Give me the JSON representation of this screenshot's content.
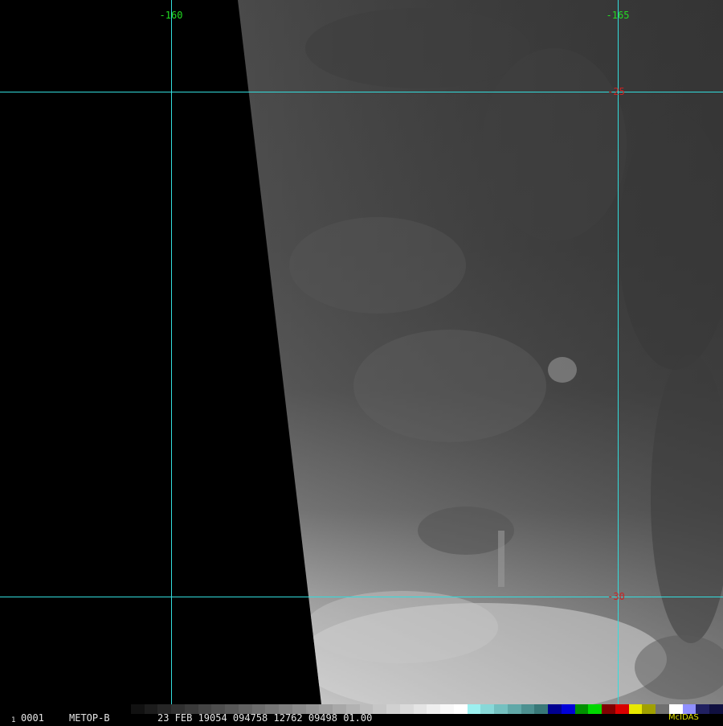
{
  "frame_number": "0001",
  "frame_marker": "1",
  "satellite": "METOP-B",
  "datetime_line": "23 FEB 19054 094758 12762 09498 01.00",
  "logo_text": "McIDAS",
  "graticule": {
    "longitude_labels": [
      "-160",
      "-165"
    ],
    "latitude_labels": [
      "-25",
      "-30"
    ],
    "line_color": "#33dddd",
    "longitude_label_color": "#22dd22",
    "latitude_label_color": "#cc2222"
  },
  "enhancement_colors": [
    "#000000",
    "#111111",
    "#1c1c1c",
    "#262626",
    "#303030",
    "#3a3a3a",
    "#444444",
    "#4e4e4e",
    "#585858",
    "#626262",
    "#6c6c6c",
    "#767676",
    "#808080",
    "#8a8a8a",
    "#949494",
    "#9e9e9e",
    "#a8a8a8",
    "#b2b2b2",
    "#bcbcbc",
    "#c6c6c6",
    "#d0d0d0",
    "#dadada",
    "#e4e4e4",
    "#eeeeee",
    "#f8f8f8",
    "#ffffff",
    "#9cf0f0",
    "#88d8d8",
    "#74c0c0",
    "#60a8a8",
    "#4c9090",
    "#387878",
    "#000090",
    "#0000d8",
    "#009000",
    "#00d800",
    "#800000",
    "#d80000",
    "#e8e800",
    "#a0a000",
    "#707070",
    "#ffffff",
    "#9090ff",
    "#202060",
    "#101040"
  ]
}
